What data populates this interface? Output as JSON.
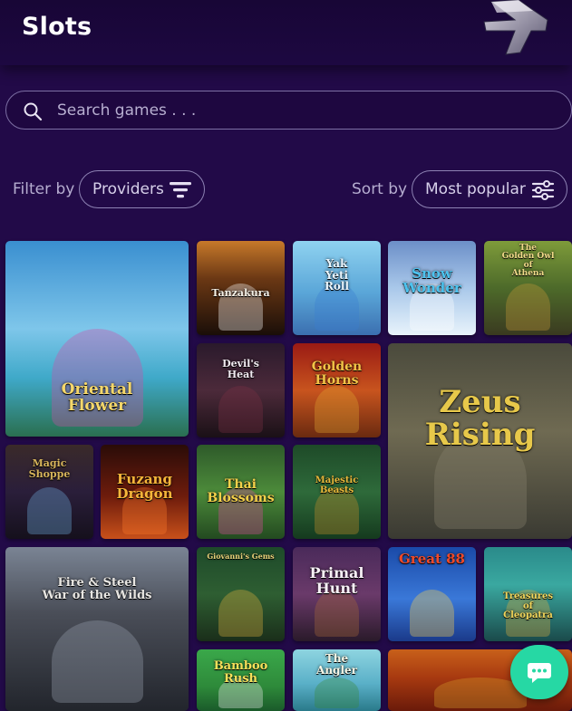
{
  "header": {
    "title": "Slots"
  },
  "search": {
    "placeholder": "Search games . . ."
  },
  "filter": {
    "label": "Filter by",
    "button_label": "Providers"
  },
  "sort": {
    "label": "Sort by",
    "button_label": "Most popular"
  },
  "games": [
    {
      "id": "oriental-flower",
      "title_lines": [
        "Oriental",
        "Flower"
      ]
    },
    {
      "id": "tanzakura",
      "title_lines": [
        "Tanzakura"
      ]
    },
    {
      "id": "yak-yeti-roll",
      "title_lines": [
        "Yak",
        "Yeti",
        "Roll"
      ]
    },
    {
      "id": "snow-wonder",
      "title_lines": [
        "Snow",
        "Wonder"
      ]
    },
    {
      "id": "golden-owl-athena",
      "title_lines": [
        "The",
        "Golden Owl",
        "of",
        "Athena"
      ]
    },
    {
      "id": "devils-heat",
      "title_lines": [
        "Devil's",
        "Heat"
      ]
    },
    {
      "id": "golden-horns",
      "title_lines": [
        "Golden",
        "Horns"
      ]
    },
    {
      "id": "zeus-rising",
      "title_lines": [
        "Zeus",
        "Rising"
      ]
    },
    {
      "id": "magic-shoppe",
      "title_lines": [
        "Magic",
        "Shoppe"
      ]
    },
    {
      "id": "fuzang-dragon",
      "title_lines": [
        "Fuzang",
        "Dragon"
      ]
    },
    {
      "id": "thai-blossoms",
      "title_lines": [
        "Thai",
        "Blossoms"
      ]
    },
    {
      "id": "majestic-beasts",
      "title_lines": [
        "Majestic",
        "Beasts"
      ]
    },
    {
      "id": "fire-steel",
      "title_lines": [
        "Fire & Steel",
        "War of the Wilds"
      ]
    },
    {
      "id": "giovannis-gems",
      "title_lines": [
        "Giovanni's Gems"
      ]
    },
    {
      "id": "primal-hunt",
      "title_lines": [
        "Primal",
        "Hunt"
      ]
    },
    {
      "id": "great-88",
      "title_lines": [
        "Great 88"
      ]
    },
    {
      "id": "treasures-cleopatra",
      "title_lines": [
        "Treasures",
        "of",
        "Cleopatra"
      ]
    },
    {
      "id": "bamboo-rush",
      "title_lines": [
        "Bamboo",
        "Rush"
      ]
    },
    {
      "id": "angler",
      "title_lines": [
        "The",
        "Angler"
      ]
    },
    {
      "id": "emperor",
      "title_lines": []
    }
  ],
  "colors": {
    "background": "#220a48",
    "accent": "#26d8a4",
    "border": "#8d82b3"
  },
  "icons": {
    "search": "search-icon",
    "filter": "filter-icon",
    "sort": "sliders-icon",
    "chat": "chat-icon",
    "logo": "brand-logo"
  }
}
